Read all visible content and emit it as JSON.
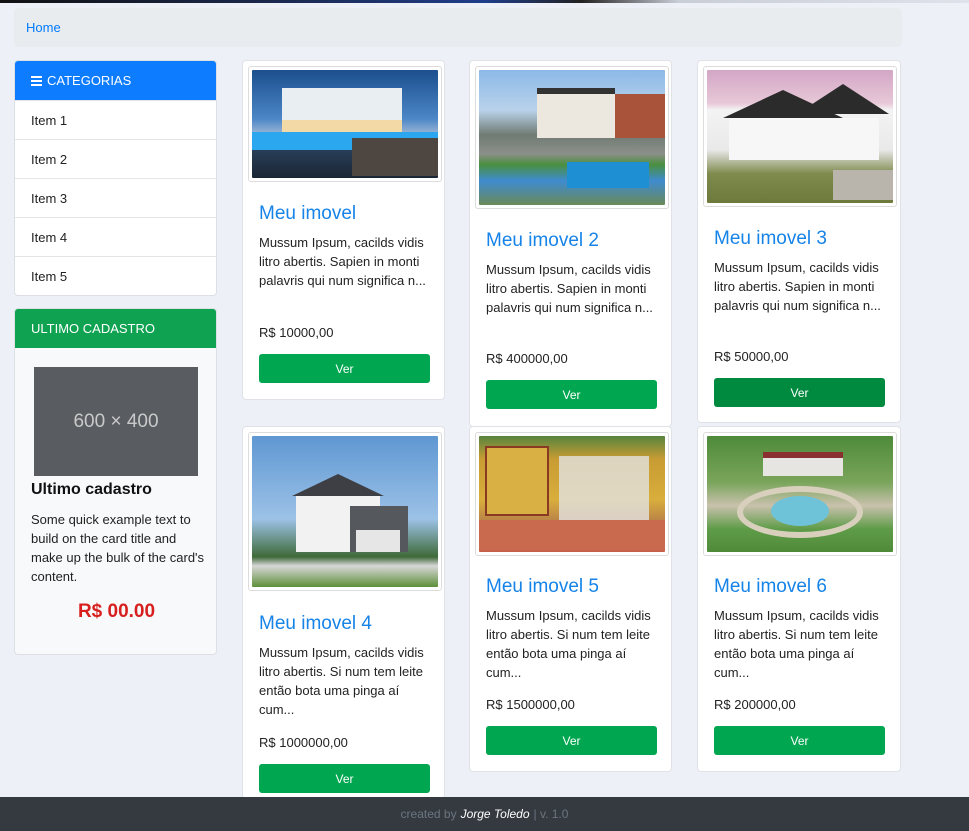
{
  "breadcrumb": {
    "home": "Home"
  },
  "sidebar": {
    "categories_title": "CATEGORIAS",
    "items": [
      {
        "label": "Item 1"
      },
      {
        "label": "Item 2"
      },
      {
        "label": "Item 3"
      },
      {
        "label": "Item 4"
      },
      {
        "label": "Item 5"
      }
    ],
    "last": {
      "header": "ULTIMO CADASTRO",
      "placeholder": "600 × 400",
      "title": "Ultimo cadastro",
      "text": "Some quick example text to build on the card title and make up the bulk of the card's content.",
      "price": "R$ 00.00"
    }
  },
  "properties": [
    {
      "title": "Meu imovel",
      "desc": "Mussum Ipsum, cacilds vidis litro abertis. Sapien in monti palavris qui num significa n...",
      "price": "R$ 10000,00",
      "button": "Ver"
    },
    {
      "title": "Meu imovel 2",
      "desc": "Mussum Ipsum, cacilds vidis litro abertis. Sapien in monti palavris qui num significa n...",
      "price": "R$ 400000,00",
      "button": "Ver"
    },
    {
      "title": "Meu imovel 3",
      "desc": "Mussum Ipsum, cacilds vidis litro abertis. Sapien in monti palavris qui num significa n...",
      "price": "R$ 50000,00",
      "button": "Ver"
    },
    {
      "title": "Meu imovel 4",
      "desc": "Mussum Ipsum, cacilds vidis litro abertis. Si num tem leite então bota uma pinga aí cum...",
      "price": "R$ 1000000,00",
      "button": "Ver"
    },
    {
      "title": "Meu imovel 5",
      "desc": "Mussum Ipsum, cacilds vidis litro abertis. Si num tem leite então bota uma pinga aí cum...",
      "price": "R$ 1500000,00",
      "button": "Ver"
    },
    {
      "title": "Meu imovel 6",
      "desc": "Mussum Ipsum, cacilds vidis litro abertis. Si num tem leite então bota uma pinga aí cum...",
      "price": "R$ 200000,00",
      "button": "Ver"
    }
  ],
  "footer": {
    "created_by": "created by",
    "author": "Jorge Toledo",
    "version": "| v. 1.0"
  },
  "colors": {
    "primary": "#0d7cff",
    "success": "#00a650",
    "price_red": "#d81f1f",
    "link": "#1683e8"
  }
}
